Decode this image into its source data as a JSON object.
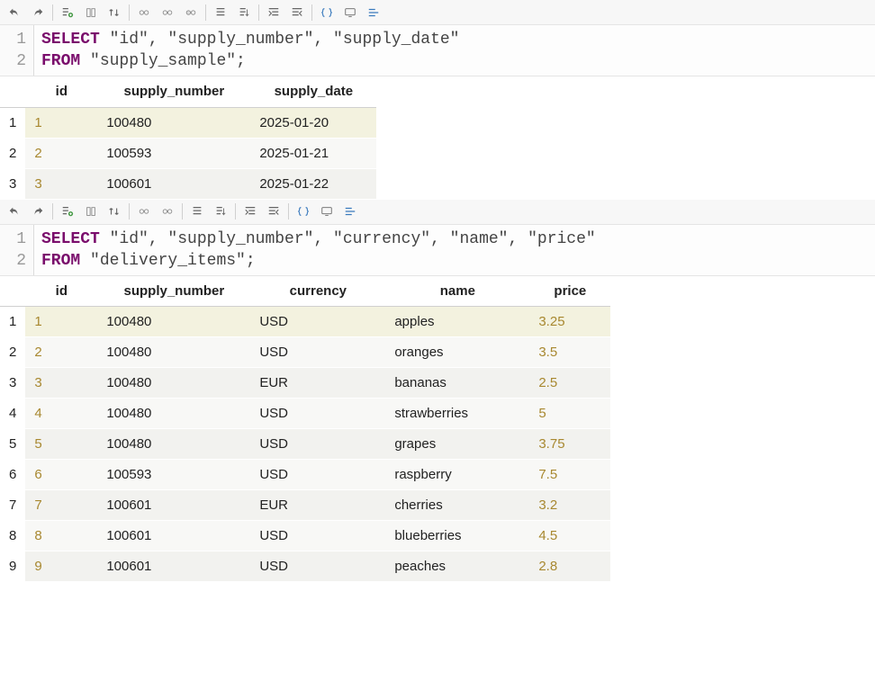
{
  "panel1": {
    "sql": {
      "line1_kw": "SELECT",
      "line1_rest": " \"id\", \"supply_number\", \"supply_date\"",
      "line2_kw": "FROM",
      "line2_rest": " \"supply_sample\";"
    },
    "columns": [
      "id",
      "supply_number",
      "supply_date"
    ],
    "rows": [
      {
        "n": "1",
        "id": "1",
        "supply_number": "100480",
        "supply_date": "2025-01-20"
      },
      {
        "n": "2",
        "id": "2",
        "supply_number": "100593",
        "supply_date": "2025-01-21"
      },
      {
        "n": "3",
        "id": "3",
        "supply_number": "100601",
        "supply_date": "2025-01-22"
      }
    ]
  },
  "panel2": {
    "sql": {
      "line1_kw": "SELECT",
      "line1_rest": " \"id\", \"supply_number\", \"currency\", \"name\", \"price\"",
      "line2_kw": "FROM",
      "line2_rest": " \"delivery_items\";"
    },
    "columns": [
      "id",
      "supply_number",
      "currency",
      "name",
      "price"
    ],
    "rows": [
      {
        "n": "1",
        "id": "1",
        "supply_number": "100480",
        "currency": "USD",
        "name": "apples",
        "price": "3.25"
      },
      {
        "n": "2",
        "id": "2",
        "supply_number": "100480",
        "currency": "USD",
        "name": "oranges",
        "price": "3.5"
      },
      {
        "n": "3",
        "id": "3",
        "supply_number": "100480",
        "currency": "EUR",
        "name": "bananas",
        "price": "2.5"
      },
      {
        "n": "4",
        "id": "4",
        "supply_number": "100480",
        "currency": "USD",
        "name": "strawberries",
        "price": "5"
      },
      {
        "n": "5",
        "id": "5",
        "supply_number": "100480",
        "currency": "USD",
        "name": "grapes",
        "price": "3.75"
      },
      {
        "n": "6",
        "id": "6",
        "supply_number": "100593",
        "currency": "USD",
        "name": "raspberry",
        "price": "7.5"
      },
      {
        "n": "7",
        "id": "7",
        "supply_number": "100601",
        "currency": "EUR",
        "name": "cherries",
        "price": "3.2"
      },
      {
        "n": "8",
        "id": "8",
        "supply_number": "100601",
        "currency": "USD",
        "name": "blueberries",
        "price": "4.5"
      },
      {
        "n": "9",
        "id": "9",
        "supply_number": "100601",
        "currency": "USD",
        "name": "peaches",
        "price": "2.8"
      }
    ]
  },
  "gutter": {
    "l1": "1",
    "l2": "2"
  }
}
